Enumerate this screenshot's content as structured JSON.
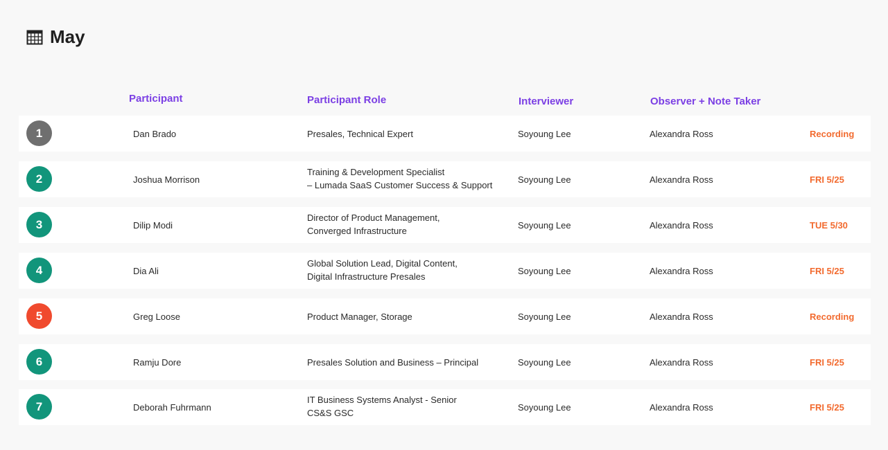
{
  "page": {
    "title": "May",
    "title_icon": "calendar-icon"
  },
  "columns": {
    "participant": "Participant",
    "role": "Participant Role",
    "interviewer": "Interviewer",
    "observer": "Observer + Note Taker"
  },
  "colors": {
    "header": "#7b3fe4",
    "status": "#f26a2e",
    "badge_gray": "#6f6f6f",
    "badge_green": "#12957b",
    "badge_red": "#f04a2e"
  },
  "rows": [
    {
      "num": "1",
      "badge": "gray",
      "name": "Dan Brado",
      "role": [
        "Presales, Technical Expert"
      ],
      "interviewer": "Soyoung Lee",
      "observer": "Alexandra Ross",
      "status": "Recording"
    },
    {
      "num": "2",
      "badge": "green",
      "name": "Joshua Morrison",
      "role": [
        "Training & Development Specialist",
        "– Lumada SaaS Customer Success & Support"
      ],
      "interviewer": "Soyoung Lee",
      "observer": "Alexandra Ross",
      "status": "FRI 5/25"
    },
    {
      "num": "3",
      "badge": "green",
      "name": "Dilip Modi",
      "role": [
        "Director of Product Management,",
        "Converged Infrastructure"
      ],
      "interviewer": "Soyoung Lee",
      "observer": "Alexandra Ross",
      "status": "TUE 5/30"
    },
    {
      "num": "4",
      "badge": "green",
      "name": "Dia Ali",
      "role": [
        "Global Solution Lead, Digital Content,",
        "Digital Infrastructure Presales"
      ],
      "interviewer": "Soyoung Lee",
      "observer": "Alexandra Ross",
      "status": "FRI 5/25"
    },
    {
      "num": "5",
      "badge": "red",
      "name": "Greg Loose",
      "role": [
        "Product Manager, Storage"
      ],
      "interviewer": "Soyoung Lee",
      "observer": "Alexandra Ross",
      "status": "Recording"
    },
    {
      "num": "6",
      "badge": "green",
      "name": "Ramju Dore",
      "role": [
        "Presales Solution and Business – Principal"
      ],
      "interviewer": "Soyoung Lee",
      "observer": "Alexandra Ross",
      "status": "FRI 5/25"
    },
    {
      "num": "7",
      "badge": "green",
      "name": "Deborah Fuhrmann",
      "role": [
        "IT Business Systems Analyst - Senior",
        "CS&S GSC"
      ],
      "interviewer": "Soyoung Lee",
      "observer": "Alexandra Ross",
      "status": "FRI 5/25"
    }
  ]
}
